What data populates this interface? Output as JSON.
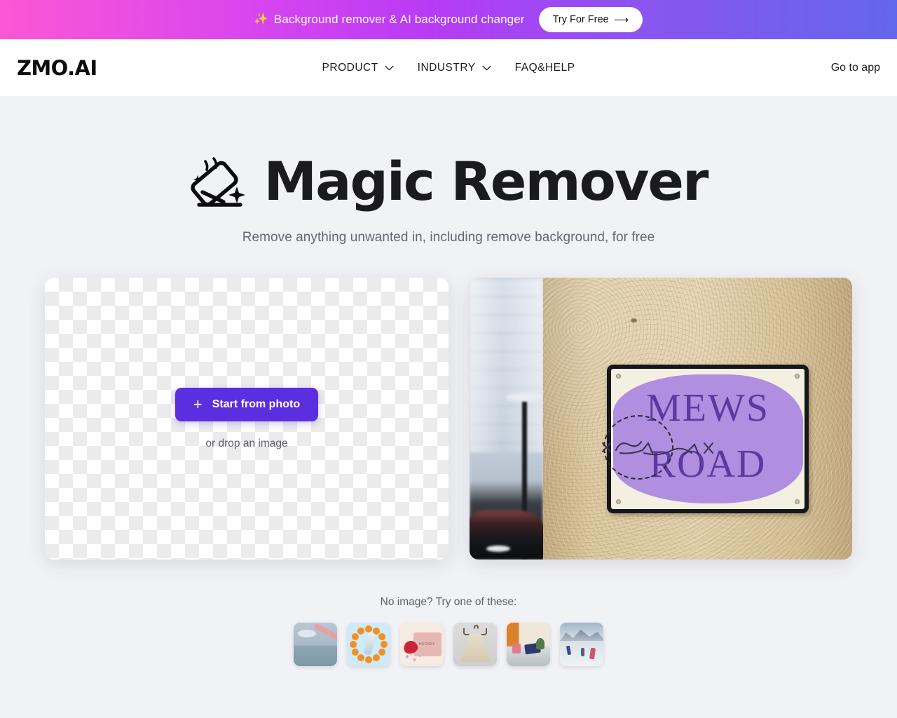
{
  "promo": {
    "sparkle_icon": "sparkles-icon",
    "text": "Background remover & AI background changer",
    "button_label": "Try For Free",
    "arrow_icon": "arrow-right-icon",
    "gradient_start": "#fb57d5",
    "gradient_end": "#6366ec"
  },
  "nav": {
    "brand": "ZMO.AI",
    "items": [
      {
        "label": "PRODUCT",
        "has_dropdown": true
      },
      {
        "label": "INDUSTRY",
        "has_dropdown": true
      },
      {
        "label": "FAQ&HELP",
        "has_dropdown": false
      }
    ],
    "go_to_app": "Go to app"
  },
  "hero": {
    "icon": "eraser-icon",
    "title": "Magic Remover",
    "subtitle": "Remove anything unwanted in, including remove background, for free"
  },
  "upload": {
    "button_label": "Start from photo",
    "plus_icon": "plus-icon",
    "drop_hint": "or drop an image",
    "button_color": "#5b2ee0"
  },
  "preview": {
    "sign_line_1": "MEWS",
    "sign_line_2": "ROAD",
    "brush_overlay": "dashed-brush-circle"
  },
  "samples": {
    "label": "No image? Try one of these:",
    "thumbs": [
      {
        "name": "sample-thumb-sky-building"
      },
      {
        "name": "sample-thumb-bottle-oranges"
      },
      {
        "name": "sample-thumb-gift-box"
      },
      {
        "name": "sample-thumb-clothing-hanger"
      },
      {
        "name": "sample-thumb-desk-tablet"
      },
      {
        "name": "sample-thumb-ski-slope"
      }
    ]
  },
  "colors": {
    "page_background": "#f1f2f6",
    "text_primary": "#1b1b1f",
    "text_secondary": "#646873",
    "accent": "#5b2ee0"
  }
}
